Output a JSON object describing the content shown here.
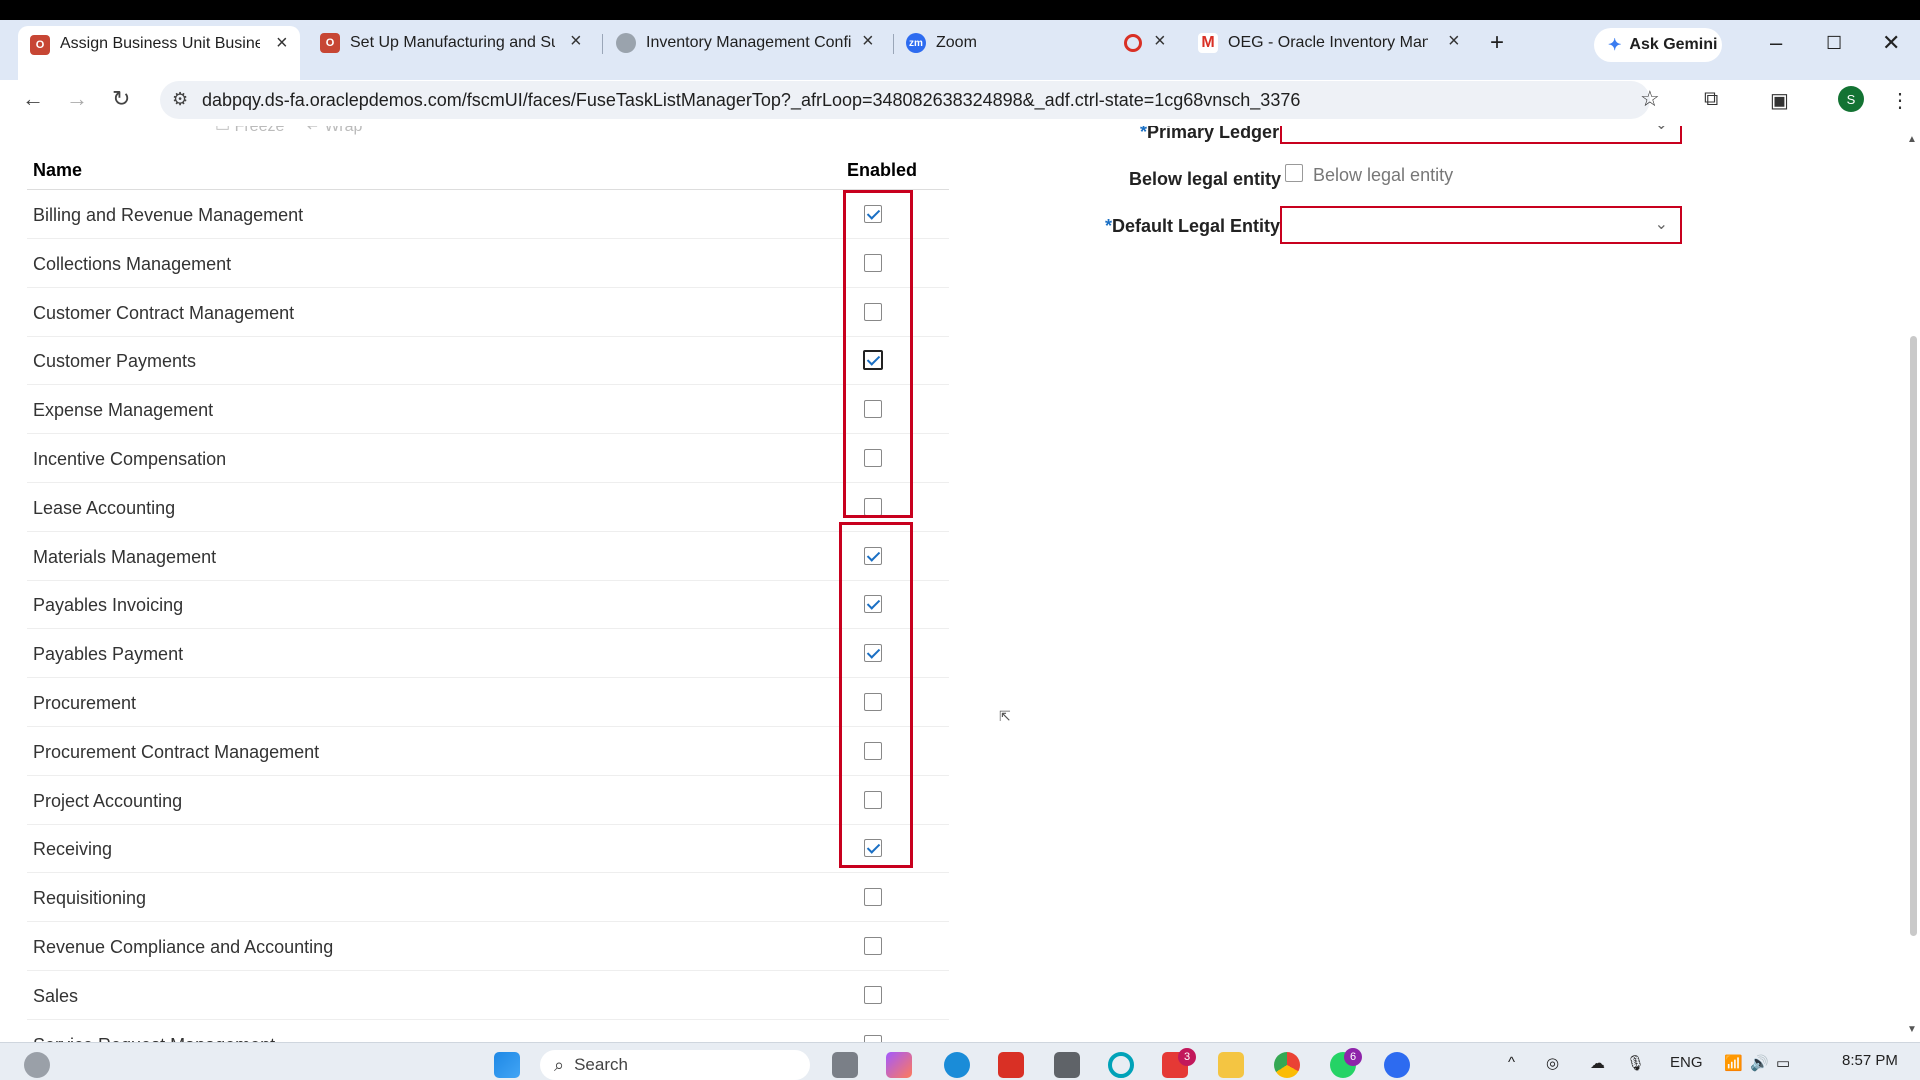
{
  "browser": {
    "tabs": [
      {
        "title": "Assign Business Unit Business",
        "icon": "oracle-icon",
        "active": true
      },
      {
        "title": "Set Up Manufacturing and Sup",
        "icon": "oracle-icon",
        "active": false
      },
      {
        "title": "Inventory Management Config",
        "icon": "globe-icon",
        "active": false
      },
      {
        "title": "Zoom",
        "icon": "zoom-icon",
        "active": false
      },
      {
        "title": "OEG - Oracle Inventory Manag",
        "icon": "gmail-icon",
        "active": false
      }
    ],
    "ask_gemini": "Ask Gemini",
    "url": "dabpqy.ds-fa.oraclepdemos.com/fscmUI/faces/FuseTaskListManagerTop?_afrLoop=348082638324898&_adf.ctrl-state=1cg68vnsch_3376",
    "profile_initial": "S"
  },
  "table": {
    "col_name": "Name",
    "col_enabled": "Enabled",
    "rows": [
      {
        "name": "Billing and Revenue Management",
        "enabled": true
      },
      {
        "name": "Collections Management",
        "enabled": false
      },
      {
        "name": "Customer Contract Management",
        "enabled": false
      },
      {
        "name": "Customer Payments",
        "enabled": true
      },
      {
        "name": "Expense Management",
        "enabled": false
      },
      {
        "name": "Incentive Compensation",
        "enabled": false
      },
      {
        "name": "Lease Accounting",
        "enabled": false
      },
      {
        "name": "Materials Management",
        "enabled": true
      },
      {
        "name": "Payables Invoicing",
        "enabled": true
      },
      {
        "name": "Payables Payment",
        "enabled": true
      },
      {
        "name": "Procurement",
        "enabled": false
      },
      {
        "name": "Procurement Contract Management",
        "enabled": false
      },
      {
        "name": "Project Accounting",
        "enabled": false
      },
      {
        "name": "Receiving",
        "enabled": true
      },
      {
        "name": "Requisitioning",
        "enabled": false
      },
      {
        "name": "Revenue Compliance and Accounting",
        "enabled": false
      },
      {
        "name": "Sales",
        "enabled": false
      },
      {
        "name": "Service Request Management",
        "enabled": false
      }
    ]
  },
  "form": {
    "primary_ledger_label": "Primary Ledger",
    "below_legal_entity_label": "Below legal entity",
    "below_legal_entity_checkbox": "Below legal entity",
    "default_legal_entity_label": "Default Legal Entity",
    "required_marker": "*"
  },
  "taskbar": {
    "search": "Search",
    "lang": "ENG",
    "time": "8:57 PM",
    "badge_a": "3",
    "badge_b": "6"
  },
  "colors": {
    "highlight_box": "#c8001e",
    "checkmark": "#1a6fc4"
  }
}
